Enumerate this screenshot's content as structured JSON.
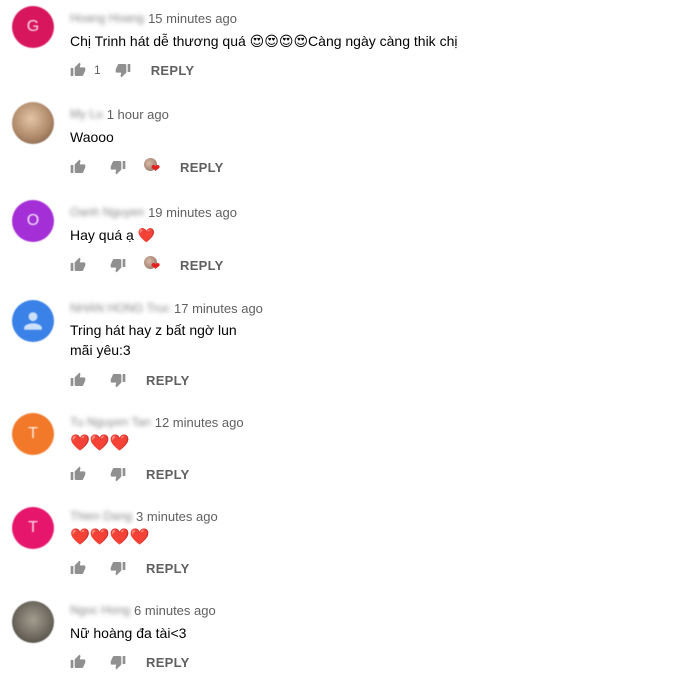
{
  "comments": [
    {
      "author": "Hoang Hoang",
      "time": "15 minutes ago",
      "text": "Chị Trinh hát dễ thương quá 😍😍😍😍Càng ngày càng thik chị",
      "likes": "1",
      "reply_label": "REPLY",
      "avatar_letter": "G",
      "avatar_color": "#d8165e",
      "creator_heart": false
    },
    {
      "author": "My Lu",
      "time": "1 hour ago",
      "text": "Waooo",
      "likes": "",
      "reply_label": "REPLY",
      "avatar_letter": "",
      "avatar_color": "#b08a6a",
      "creator_heart": true
    },
    {
      "author": "Oanh Nguyen",
      "time": "19 minutes ago",
      "text": "Hay quá ạ ❤️",
      "likes": "",
      "reply_label": "REPLY",
      "avatar_letter": "O",
      "avatar_color": "#a52fd6",
      "creator_heart": true
    },
    {
      "author": "NHAN HONG Truc",
      "time": "17 minutes ago",
      "text": "Tring hát hay z bất ngờ lun\nmãi yêu:3",
      "likes": "",
      "reply_label": "REPLY",
      "avatar_letter": "",
      "avatar_color": "#3b82e8",
      "creator_heart": false
    },
    {
      "author": "Tu Nguyen Tan",
      "time": "12 minutes ago",
      "text": "❤️❤️❤️",
      "likes": "",
      "reply_label": "REPLY",
      "avatar_letter": "T",
      "avatar_color": "#f2782a",
      "creator_heart": false
    },
    {
      "author": "Thien Dang",
      "time": "3 minutes ago",
      "text": "❤️❤️❤️❤️",
      "likes": "",
      "reply_label": "REPLY",
      "avatar_letter": "T",
      "avatar_color": "#e6166c",
      "creator_heart": false
    },
    {
      "author": "Ngoc Hong",
      "time": "6 minutes ago",
      "text": "Nữ hoàng đa tài<3",
      "likes": "",
      "reply_label": "REPLY",
      "avatar_letter": "",
      "avatar_color": "#6f6a60",
      "creator_heart": false
    }
  ]
}
